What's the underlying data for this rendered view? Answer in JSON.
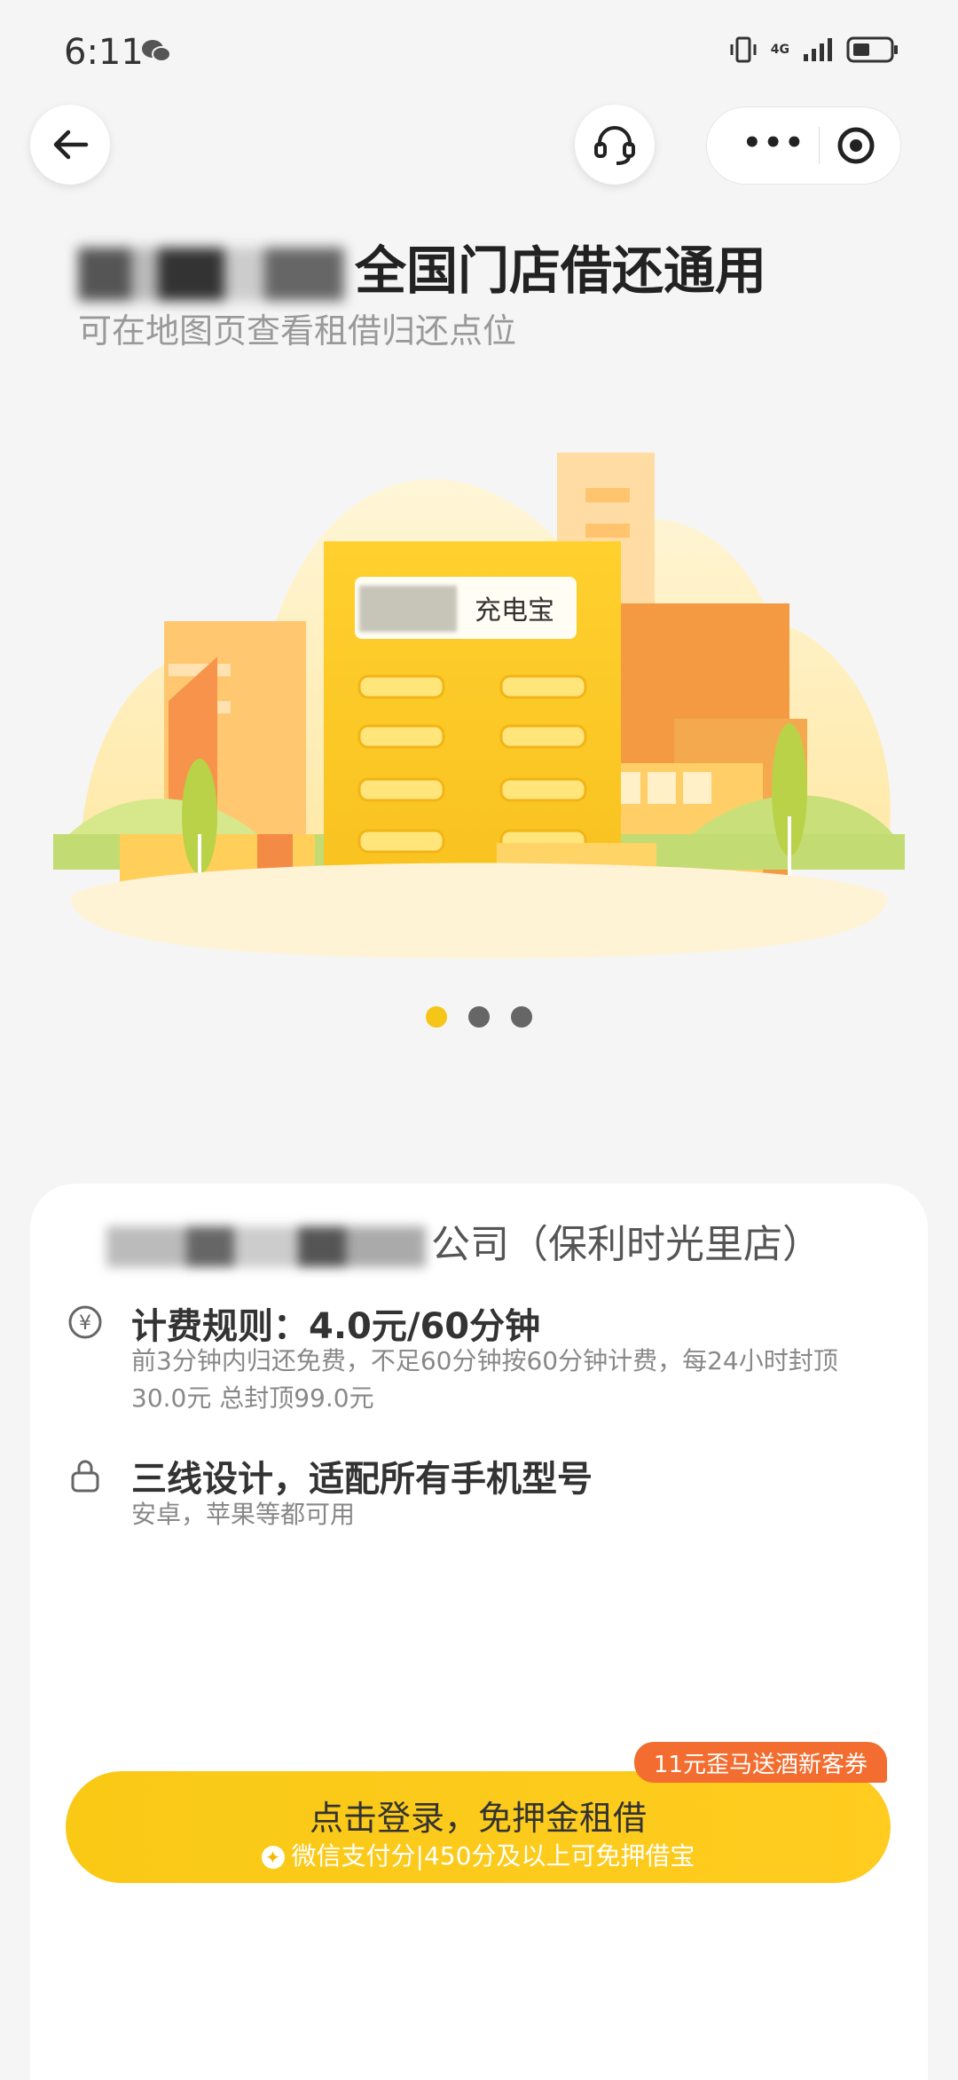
{
  "status": {
    "time": "6:11",
    "network": "4G"
  },
  "header": {
    "title_suffix": "全国门店借还通用",
    "subtitle": "可在地图页查看租借归还点位"
  },
  "banner": {
    "sign_text": "充电宝",
    "pages": 3,
    "active_page": 1
  },
  "store": {
    "name_suffix": "公司（保利时光里店）"
  },
  "pricing": {
    "title": "计费规则：4.0元/60分钟",
    "desc": "前3分钟内归还免费，不足60分钟按60分钟计费，每24小时封顶30.0元 总封顶99.0元"
  },
  "compat": {
    "title": "三线设计，适配所有手机型号",
    "desc": "安卓，苹果等都可用"
  },
  "coupon": {
    "label": "11元歪马送酒新客券"
  },
  "login": {
    "label": "点击登录，免押金租借",
    "sub": "微信支付分|450分及以上可免押借宝"
  },
  "colors": {
    "primary": "#f9c916",
    "coupon": "#f26d2f",
    "building": "#f7c42a"
  }
}
